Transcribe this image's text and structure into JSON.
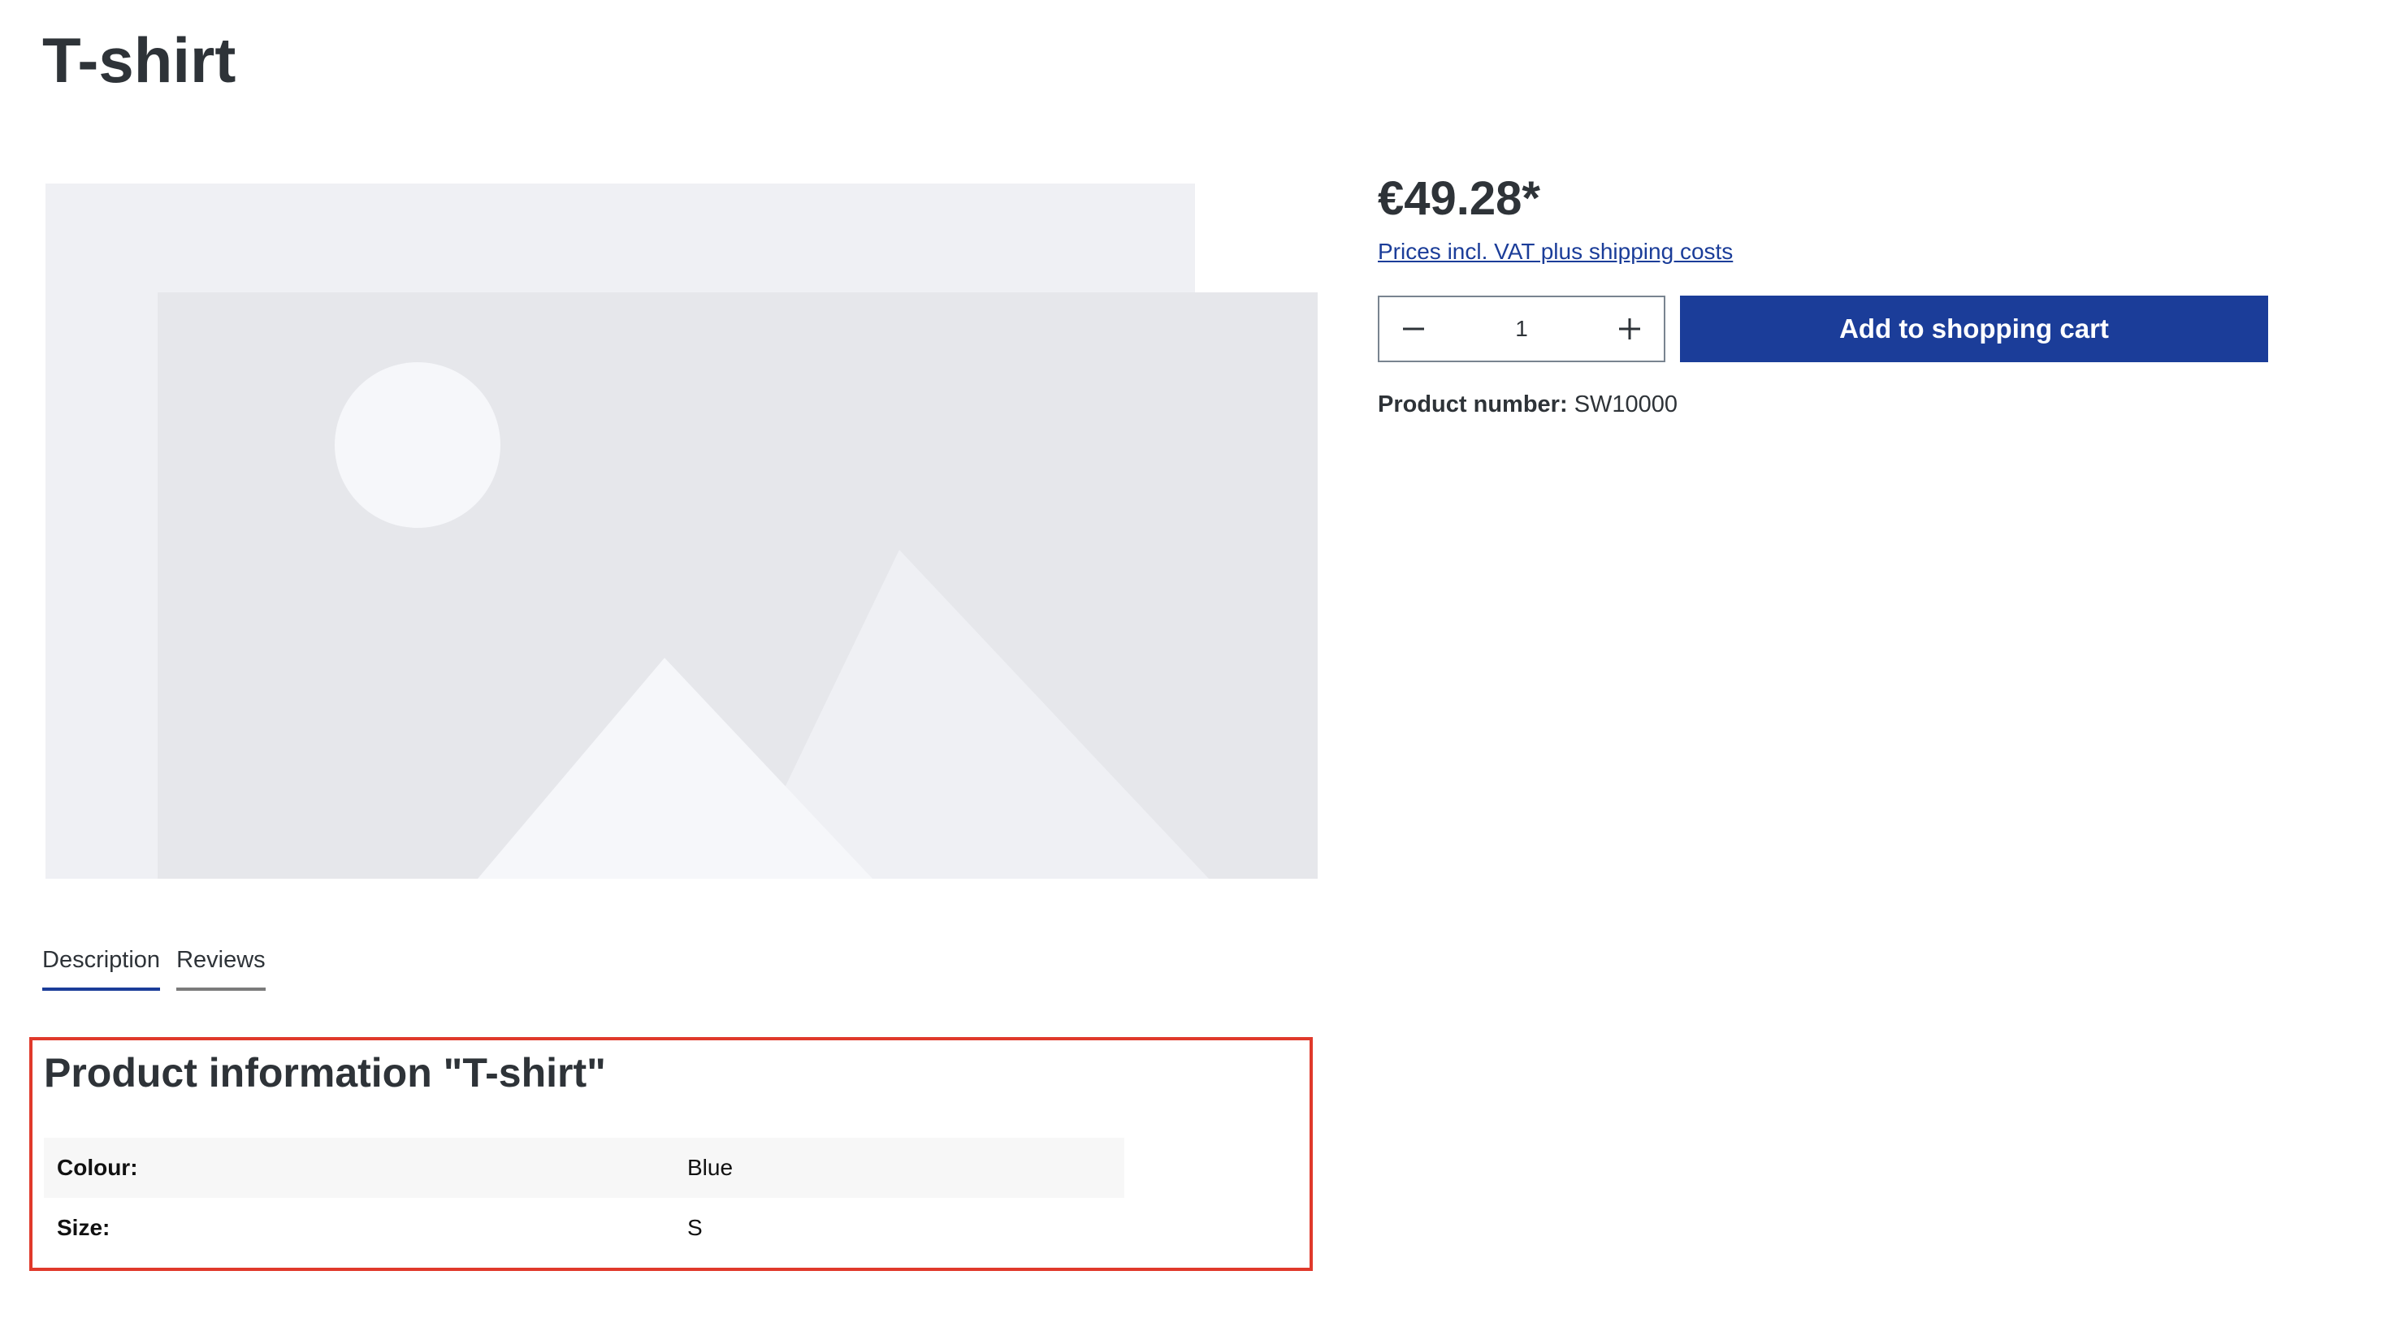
{
  "product": {
    "title": "T-shirt",
    "price": "€49.28*",
    "vat_note": "Prices incl. VAT plus shipping costs",
    "quantity": "1",
    "add_to_cart_label": "Add to shopping cart",
    "product_number_label": "Product number:",
    "product_number": "SW10000"
  },
  "tabs": [
    {
      "label": "Description",
      "active": true
    },
    {
      "label": "Reviews",
      "active": false
    }
  ],
  "description": {
    "heading": "Product information \"T-shirt\"",
    "properties": [
      {
        "label": "Colour:",
        "value": "Blue"
      },
      {
        "label": "Size:",
        "value": "S"
      }
    ]
  },
  "icons": {
    "gallery": "image-placeholder-icon",
    "minus": "minus-icon",
    "plus": "plus-icon"
  },
  "colors": {
    "accent": "#1b3d99",
    "highlight_border": "#e0392b"
  }
}
